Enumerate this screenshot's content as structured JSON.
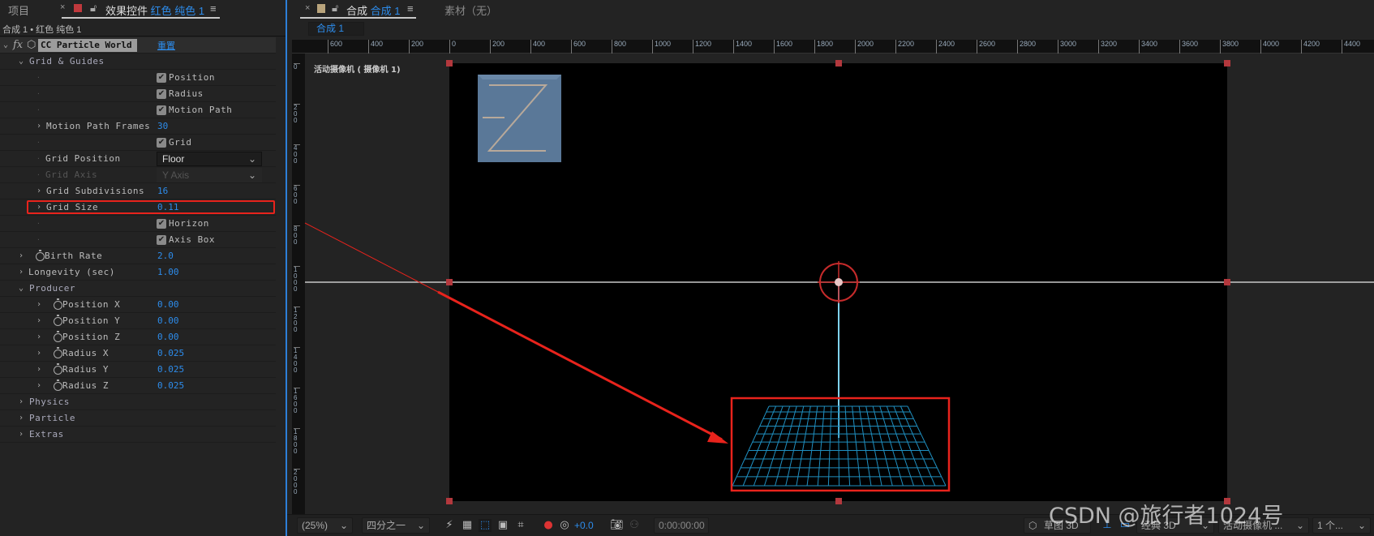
{
  "left_panel": {
    "tabs": {
      "project": "项目",
      "effects_prefix": "效果控件",
      "effects_layer": "红色 纯色 1",
      "close": "×",
      "menu": "≡"
    },
    "breadcrumb": "合成 1 • 红色 纯色 1",
    "effect": {
      "name": "CC Particle World",
      "reset": "重置",
      "fx": "fx"
    },
    "rows": [
      {
        "type": "group",
        "label": "Grid & Guides",
        "indent": 1,
        "open": true
      },
      {
        "type": "check",
        "label": "Position"
      },
      {
        "type": "check",
        "label": "Radius"
      },
      {
        "type": "check",
        "label": "Motion Path"
      },
      {
        "type": "prop",
        "label": "Motion Path Frames",
        "value": "30",
        "indent": 2
      },
      {
        "type": "check",
        "label": "Grid"
      },
      {
        "type": "drop",
        "label": "Grid Position",
        "value": "Floor"
      },
      {
        "type": "drop",
        "label": "Grid Axis",
        "value": "Y Axis",
        "disabled": true
      },
      {
        "type": "prop",
        "label": "Grid Subdivisions",
        "value": "16",
        "indent": 2
      },
      {
        "type": "prop",
        "label": "Grid Size",
        "value": "0.11",
        "indent": 2,
        "highlight": true
      },
      {
        "type": "check",
        "label": "Horizon"
      },
      {
        "type": "check",
        "label": "Axis Box"
      },
      {
        "type": "prop",
        "label": "Birth Rate",
        "value": "2.0",
        "indent": 1,
        "stopwatch": true
      },
      {
        "type": "prop",
        "label": "Longevity (sec)",
        "value": "1.00",
        "indent": 1
      },
      {
        "type": "group",
        "label": "Producer",
        "indent": 1,
        "open": true
      },
      {
        "type": "prop",
        "label": "Position X",
        "value": "0.00",
        "indent": 2,
        "stopwatch": true
      },
      {
        "type": "prop",
        "label": "Position Y",
        "value": "0.00",
        "indent": 2,
        "stopwatch": true
      },
      {
        "type": "prop",
        "label": "Position Z",
        "value": "0.00",
        "indent": 2,
        "stopwatch": true
      },
      {
        "type": "prop",
        "label": "Radius X",
        "value": "0.025",
        "indent": 2,
        "stopwatch": true
      },
      {
        "type": "prop",
        "label": "Radius Y",
        "value": "0.025",
        "indent": 2,
        "stopwatch": true
      },
      {
        "type": "prop",
        "label": "Radius Z",
        "value": "0.025",
        "indent": 2,
        "stopwatch": true
      },
      {
        "type": "group",
        "label": "Physics",
        "indent": 1
      },
      {
        "type": "group",
        "label": "Particle",
        "indent": 1
      },
      {
        "type": "group",
        "label": "Extras",
        "indent": 1
      }
    ]
  },
  "viewer": {
    "tab_prefix": "合成",
    "tab_comp": "合成 1",
    "footage_tab": "素材（无）",
    "close": "×",
    "menu": "≡",
    "comp_subtab": "合成 1",
    "camera_label": "活动摄像机 ( 摄像机 1)",
    "ruler_h": [
      -600,
      -400,
      -200,
      0,
      200,
      400,
      600,
      800,
      1000,
      1200,
      1400,
      1600,
      1800,
      2000,
      2200,
      2400,
      2600,
      2800,
      3000,
      3200,
      3400,
      3600,
      3800,
      4000,
      4200,
      4400
    ],
    "ruler_v": [
      0,
      200,
      400,
      600,
      800,
      1000,
      1200,
      1400,
      1600,
      1800,
      2000
    ],
    "grid_color": "#1f8fc0",
    "annotation_color": "#e8231c"
  },
  "bottom_bar": {
    "zoom": "(25%)",
    "resolution": "四分之一",
    "exposure": "+0.0",
    "timecode": "0:00:00:00",
    "draft3d": "草图 3D",
    "renderer": "经典 3D",
    "camera": "活动摄像机 ...",
    "views": "1 个..."
  },
  "watermark": "CSDN @旅行者1024号"
}
